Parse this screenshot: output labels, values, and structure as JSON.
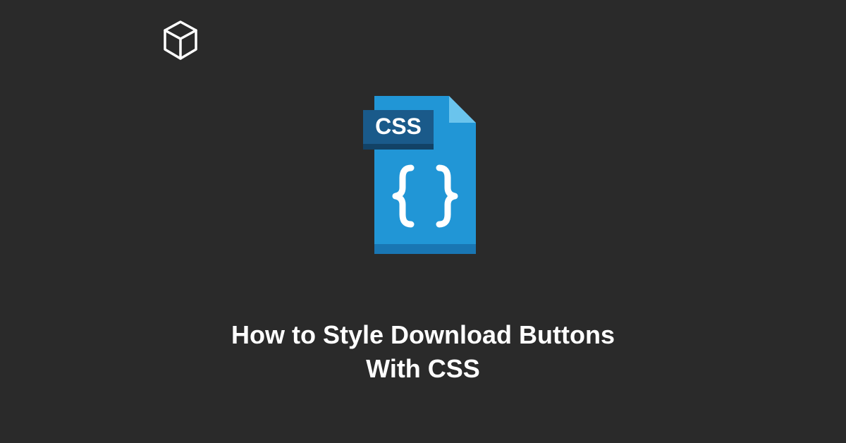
{
  "title_line1": "How to Style Download Buttons",
  "title_line2": "With CSS",
  "icon": {
    "badge_label": "CSS",
    "colors": {
      "file_main": "#2196d6",
      "file_shadow": "#1976b3",
      "fold_light": "#6ac4ed",
      "fold_dark": "#1976b3",
      "badge_bg": "#1a5a8a",
      "badge_shadow": "#124266",
      "badge_text": "#ffffff",
      "curly": "#ffffff"
    }
  },
  "logo": {
    "stroke": "#ffffff"
  },
  "colors": {
    "background": "#2a2a2a",
    "text": "#ffffff"
  }
}
